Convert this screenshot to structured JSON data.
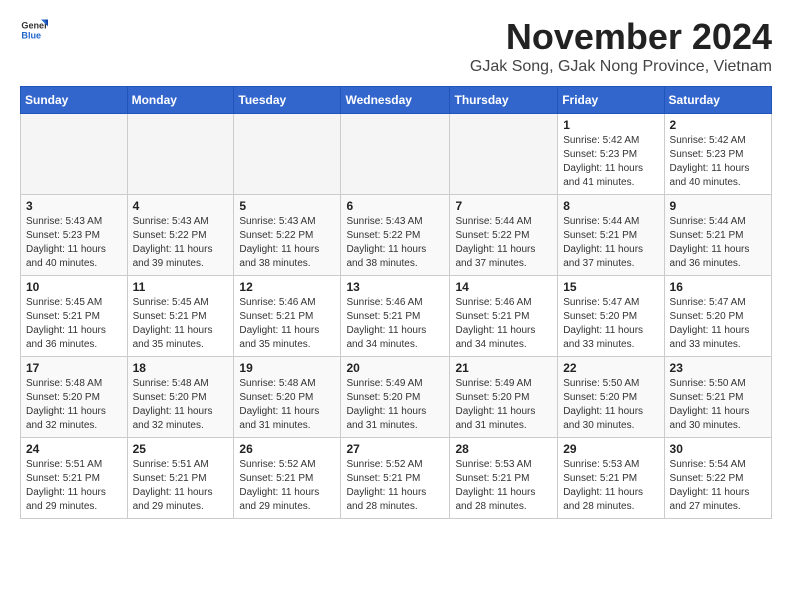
{
  "logo": {
    "text_general": "General",
    "text_blue": "Blue"
  },
  "title": "November 2024",
  "subtitle": "GJak Song, GJak Nong Province, Vietnam",
  "weekdays": [
    "Sunday",
    "Monday",
    "Tuesday",
    "Wednesday",
    "Thursday",
    "Friday",
    "Saturday"
  ],
  "weeks": [
    [
      {
        "day": "",
        "info": "",
        "empty": true
      },
      {
        "day": "",
        "info": "",
        "empty": true
      },
      {
        "day": "",
        "info": "",
        "empty": true
      },
      {
        "day": "",
        "info": "",
        "empty": true
      },
      {
        "day": "",
        "info": "",
        "empty": true
      },
      {
        "day": "1",
        "info": "Sunrise: 5:42 AM\nSunset: 5:23 PM\nDaylight: 11 hours and 41 minutes."
      },
      {
        "day": "2",
        "info": "Sunrise: 5:42 AM\nSunset: 5:23 PM\nDaylight: 11 hours and 40 minutes."
      }
    ],
    [
      {
        "day": "3",
        "info": "Sunrise: 5:43 AM\nSunset: 5:23 PM\nDaylight: 11 hours and 40 minutes."
      },
      {
        "day": "4",
        "info": "Sunrise: 5:43 AM\nSunset: 5:22 PM\nDaylight: 11 hours and 39 minutes."
      },
      {
        "day": "5",
        "info": "Sunrise: 5:43 AM\nSunset: 5:22 PM\nDaylight: 11 hours and 38 minutes."
      },
      {
        "day": "6",
        "info": "Sunrise: 5:43 AM\nSunset: 5:22 PM\nDaylight: 11 hours and 38 minutes."
      },
      {
        "day": "7",
        "info": "Sunrise: 5:44 AM\nSunset: 5:22 PM\nDaylight: 11 hours and 37 minutes."
      },
      {
        "day": "8",
        "info": "Sunrise: 5:44 AM\nSunset: 5:21 PM\nDaylight: 11 hours and 37 minutes."
      },
      {
        "day": "9",
        "info": "Sunrise: 5:44 AM\nSunset: 5:21 PM\nDaylight: 11 hours and 36 minutes."
      }
    ],
    [
      {
        "day": "10",
        "info": "Sunrise: 5:45 AM\nSunset: 5:21 PM\nDaylight: 11 hours and 36 minutes."
      },
      {
        "day": "11",
        "info": "Sunrise: 5:45 AM\nSunset: 5:21 PM\nDaylight: 11 hours and 35 minutes."
      },
      {
        "day": "12",
        "info": "Sunrise: 5:46 AM\nSunset: 5:21 PM\nDaylight: 11 hours and 35 minutes."
      },
      {
        "day": "13",
        "info": "Sunrise: 5:46 AM\nSunset: 5:21 PM\nDaylight: 11 hours and 34 minutes."
      },
      {
        "day": "14",
        "info": "Sunrise: 5:46 AM\nSunset: 5:21 PM\nDaylight: 11 hours and 34 minutes."
      },
      {
        "day": "15",
        "info": "Sunrise: 5:47 AM\nSunset: 5:20 PM\nDaylight: 11 hours and 33 minutes."
      },
      {
        "day": "16",
        "info": "Sunrise: 5:47 AM\nSunset: 5:20 PM\nDaylight: 11 hours and 33 minutes."
      }
    ],
    [
      {
        "day": "17",
        "info": "Sunrise: 5:48 AM\nSunset: 5:20 PM\nDaylight: 11 hours and 32 minutes."
      },
      {
        "day": "18",
        "info": "Sunrise: 5:48 AM\nSunset: 5:20 PM\nDaylight: 11 hours and 32 minutes."
      },
      {
        "day": "19",
        "info": "Sunrise: 5:48 AM\nSunset: 5:20 PM\nDaylight: 11 hours and 31 minutes."
      },
      {
        "day": "20",
        "info": "Sunrise: 5:49 AM\nSunset: 5:20 PM\nDaylight: 11 hours and 31 minutes."
      },
      {
        "day": "21",
        "info": "Sunrise: 5:49 AM\nSunset: 5:20 PM\nDaylight: 11 hours and 31 minutes."
      },
      {
        "day": "22",
        "info": "Sunrise: 5:50 AM\nSunset: 5:20 PM\nDaylight: 11 hours and 30 minutes."
      },
      {
        "day": "23",
        "info": "Sunrise: 5:50 AM\nSunset: 5:21 PM\nDaylight: 11 hours and 30 minutes."
      }
    ],
    [
      {
        "day": "24",
        "info": "Sunrise: 5:51 AM\nSunset: 5:21 PM\nDaylight: 11 hours and 29 minutes."
      },
      {
        "day": "25",
        "info": "Sunrise: 5:51 AM\nSunset: 5:21 PM\nDaylight: 11 hours and 29 minutes."
      },
      {
        "day": "26",
        "info": "Sunrise: 5:52 AM\nSunset: 5:21 PM\nDaylight: 11 hours and 29 minutes."
      },
      {
        "day": "27",
        "info": "Sunrise: 5:52 AM\nSunset: 5:21 PM\nDaylight: 11 hours and 28 minutes."
      },
      {
        "day": "28",
        "info": "Sunrise: 5:53 AM\nSunset: 5:21 PM\nDaylight: 11 hours and 28 minutes."
      },
      {
        "day": "29",
        "info": "Sunrise: 5:53 AM\nSunset: 5:21 PM\nDaylight: 11 hours and 28 minutes."
      },
      {
        "day": "30",
        "info": "Sunrise: 5:54 AM\nSunset: 5:22 PM\nDaylight: 11 hours and 27 minutes."
      }
    ]
  ]
}
